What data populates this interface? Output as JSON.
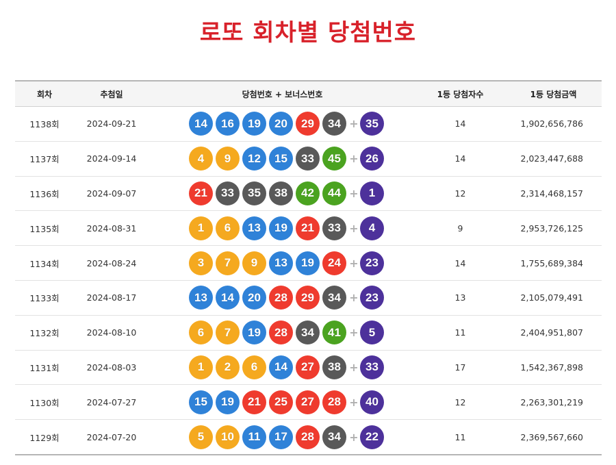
{
  "page": {
    "title": "로또 회차별 당첨번호"
  },
  "table": {
    "headers": {
      "round": "회차",
      "date": "추첨일",
      "numbers": "당첨번호 + 보너스번호",
      "winners": "1등 당첨자수",
      "amount": "1등 당첨금액"
    },
    "plus_symbol": "+",
    "rows": [
      {
        "round": "1138회",
        "date": "2024-09-21",
        "numbers": [
          "14",
          "16",
          "19",
          "20",
          "29",
          "34"
        ],
        "bonus": "35",
        "winners": "14",
        "amount": "1,902,656,786"
      },
      {
        "round": "1137회",
        "date": "2024-09-14",
        "numbers": [
          "4",
          "9",
          "12",
          "15",
          "33",
          "45"
        ],
        "bonus": "26",
        "winners": "14",
        "amount": "2,023,447,688"
      },
      {
        "round": "1136회",
        "date": "2024-09-07",
        "numbers": [
          "21",
          "33",
          "35",
          "38",
          "42",
          "44"
        ],
        "bonus": "1",
        "winners": "12",
        "amount": "2,314,468,157"
      },
      {
        "round": "1135회",
        "date": "2024-08-31",
        "numbers": [
          "1",
          "6",
          "13",
          "19",
          "21",
          "33"
        ],
        "bonus": "4",
        "winners": "9",
        "amount": "2,953,726,125"
      },
      {
        "round": "1134회",
        "date": "2024-08-24",
        "numbers": [
          "3",
          "7",
          "9",
          "13",
          "19",
          "24"
        ],
        "bonus": "23",
        "winners": "14",
        "amount": "1,755,689,384"
      },
      {
        "round": "1133회",
        "date": "2024-08-17",
        "numbers": [
          "13",
          "14",
          "20",
          "28",
          "29",
          "34"
        ],
        "bonus": "23",
        "winners": "13",
        "amount": "2,105,079,491"
      },
      {
        "round": "1132회",
        "date": "2024-08-10",
        "numbers": [
          "6",
          "7",
          "19",
          "28",
          "34",
          "41"
        ],
        "bonus": "5",
        "winners": "11",
        "amount": "2,404,951,807"
      },
      {
        "round": "1131회",
        "date": "2024-08-03",
        "numbers": [
          "1",
          "2",
          "6",
          "14",
          "27",
          "38"
        ],
        "bonus": "33",
        "winners": "17",
        "amount": "1,542,367,898"
      },
      {
        "round": "1130회",
        "date": "2024-07-27",
        "numbers": [
          "15",
          "19",
          "21",
          "25",
          "27",
          "28"
        ],
        "bonus": "40",
        "winners": "12",
        "amount": "2,263,301,219"
      },
      {
        "round": "1129회",
        "date": "2024-07-20",
        "numbers": [
          "5",
          "10",
          "11",
          "17",
          "28",
          "34"
        ],
        "bonus": "22",
        "winners": "11",
        "amount": "2,369,567,660"
      }
    ]
  },
  "ball_colors": {
    "1-10": "#f5a91f",
    "11-20": "#2f82d8",
    "21-30": "#ef3b2e",
    "31-40": "#595959",
    "41-45": "#4ba320",
    "bonus": "#4d319b"
  }
}
